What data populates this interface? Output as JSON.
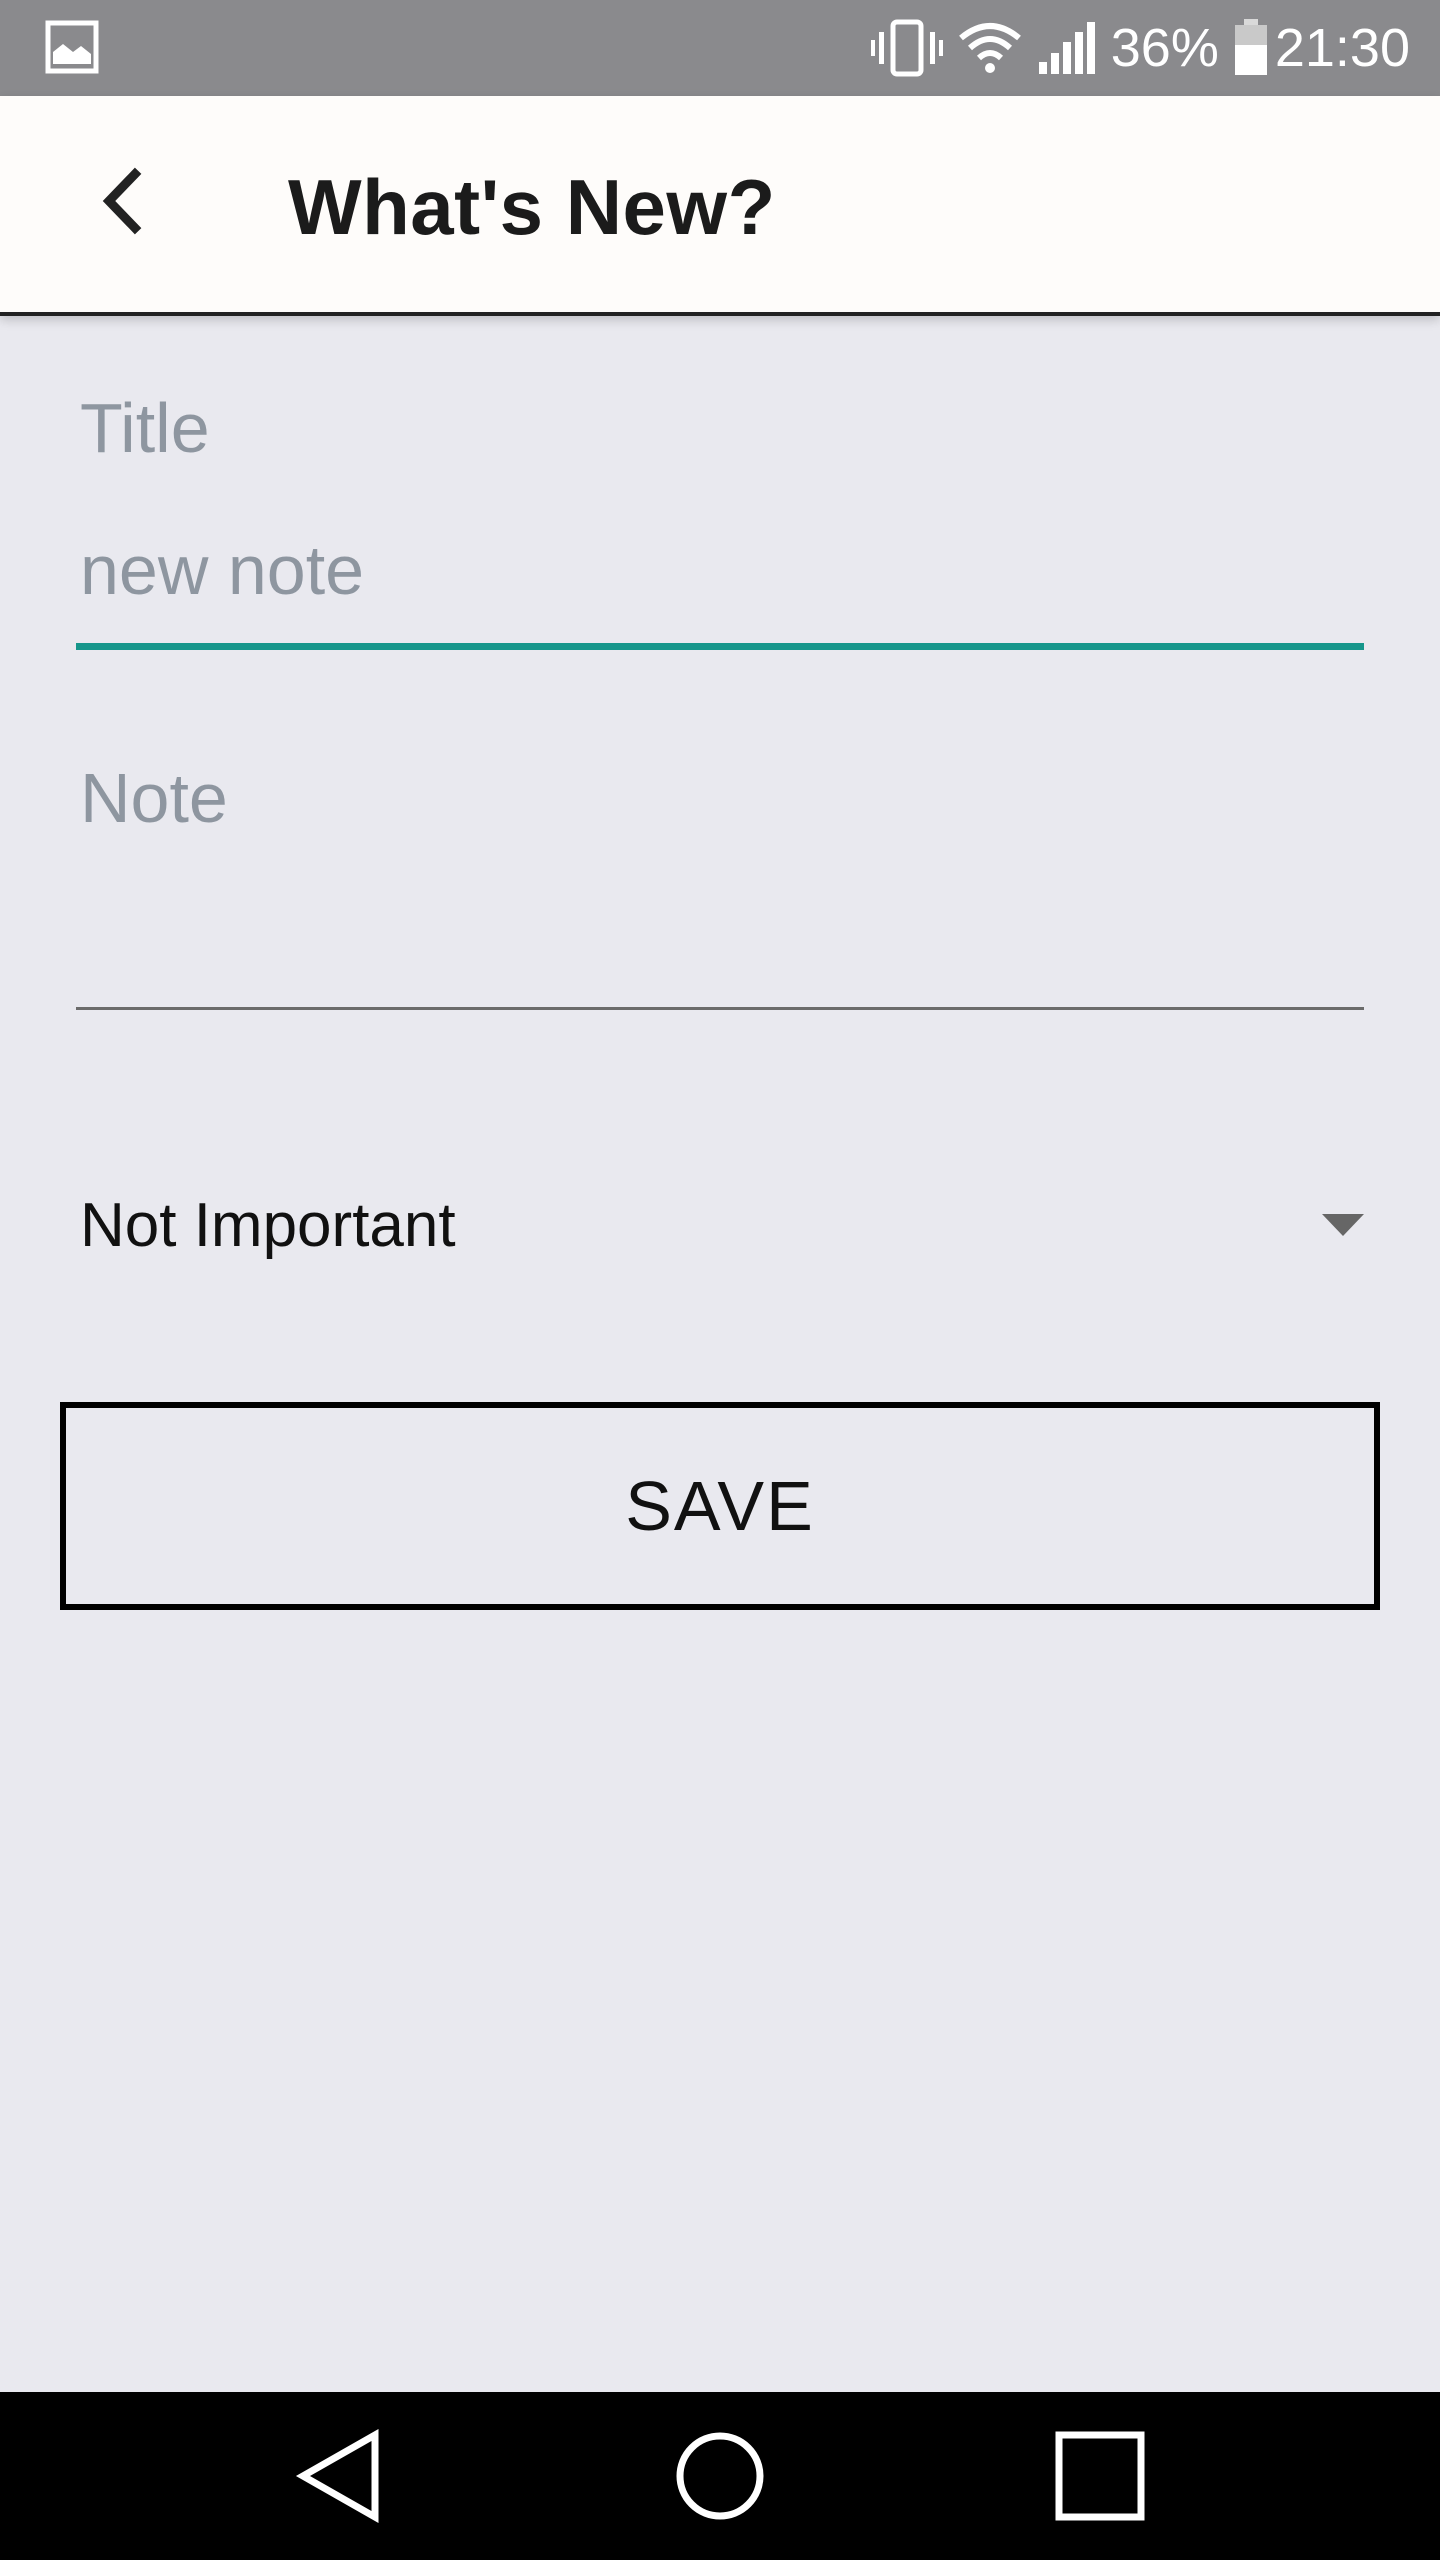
{
  "status_bar": {
    "battery_percent": "36%",
    "time": "21:30",
    "icons": [
      "gallery-icon",
      "vibrate-icon",
      "wifi-icon",
      "signal-icon",
      "battery-icon"
    ]
  },
  "app_bar": {
    "title": "What's New?",
    "back_icon": "back-arrow-icon"
  },
  "form": {
    "title_label": "Title",
    "title_placeholder": "new note",
    "note_placeholder": "Note",
    "priority_selected": "Not Important",
    "save_label": "SAVE",
    "accent_color": "#16968b"
  },
  "nav_bar": {
    "icons": [
      "nav-back-icon",
      "nav-home-icon",
      "nav-recents-icon"
    ]
  }
}
